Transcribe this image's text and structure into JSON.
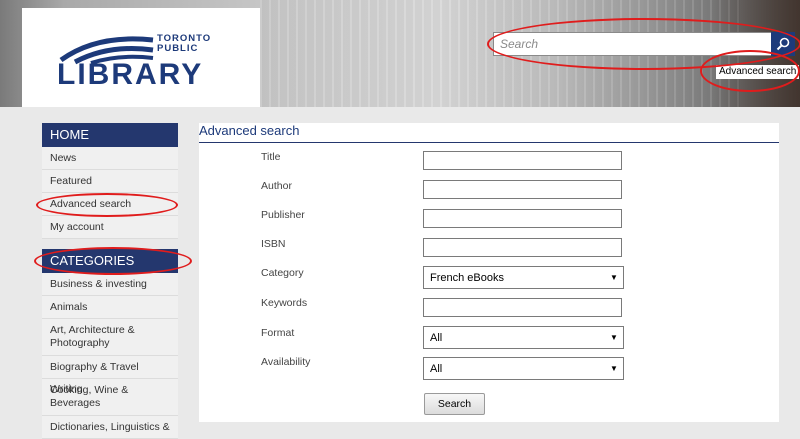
{
  "header": {
    "logo": {
      "line1": "TORONTO",
      "line2": "PUBLIC",
      "line3": "LIBRARY"
    },
    "search": {
      "placeholder": "Search",
      "value": ""
    },
    "advanced_search_link": "Advanced search",
    "icons": {
      "search_button": "search-icon"
    }
  },
  "sidebar": {
    "home_heading": "HOME",
    "home_items": [
      {
        "label": "News"
      },
      {
        "label": "Featured"
      },
      {
        "label": "Advanced search"
      },
      {
        "label": "My account"
      }
    ],
    "categories_heading": "CATEGORIES",
    "category_items": [
      {
        "label": "Business & investing"
      },
      {
        "label": "Animals"
      },
      {
        "label": "Art, Architecture & Photography"
      },
      {
        "label": "Biography & Travel Writing"
      },
      {
        "label": "Cooking, Wine & Beverages"
      },
      {
        "label": "Dictionaries, Linguistics &"
      }
    ]
  },
  "main": {
    "title": "Advanced search",
    "fields": [
      {
        "label": "Title",
        "value": ""
      },
      {
        "label": "Author",
        "value": ""
      },
      {
        "label": "Publisher",
        "value": ""
      },
      {
        "label": "ISBN",
        "value": ""
      },
      {
        "label": "Category",
        "selected": "French eBooks"
      },
      {
        "label": "Keywords",
        "value": ""
      },
      {
        "label": "Format",
        "selected": "All"
      },
      {
        "label": "Availability",
        "selected": "All"
      }
    ],
    "submit_label": "Search"
  },
  "colors": {
    "brand_navy": "#24376e",
    "annotation_red": "#e01c1c",
    "sidebar_bg": "#f0f0f0",
    "page_bg": "#e9e9e9"
  }
}
